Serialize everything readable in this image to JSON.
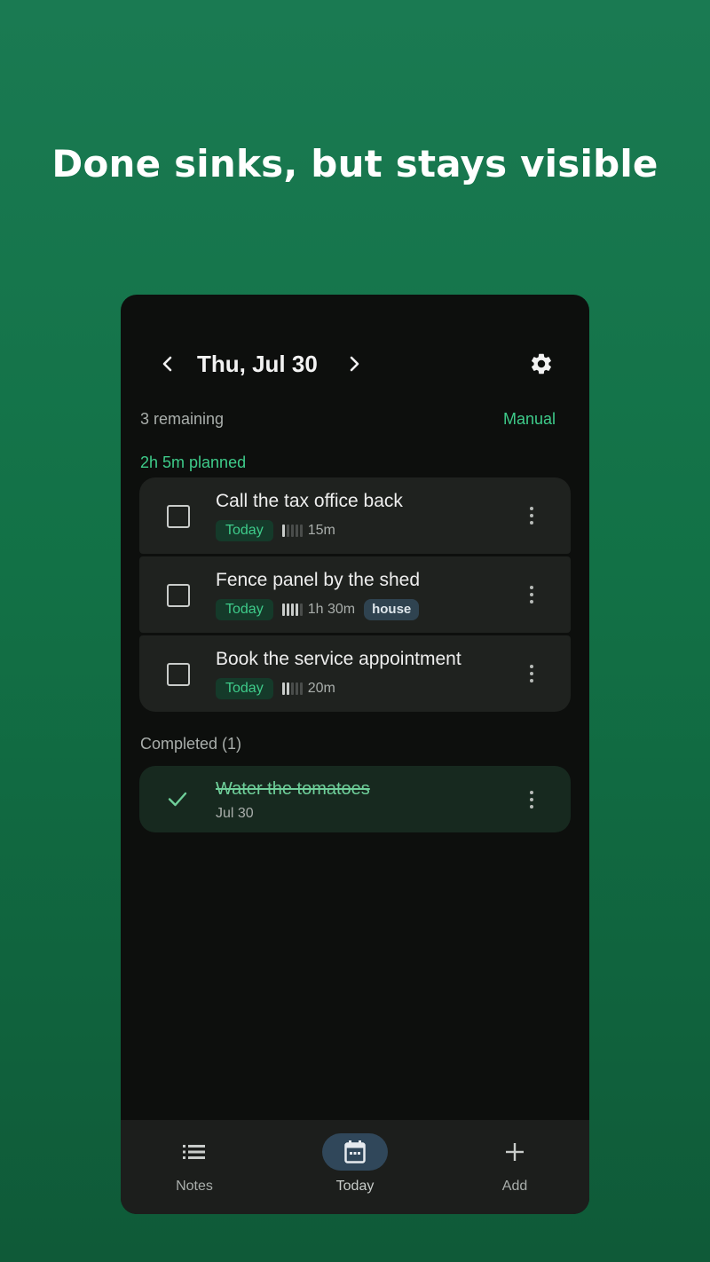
{
  "headline": "Done sinks, but stays visible",
  "header": {
    "date_title": "Thu, Jul 30",
    "prev_icon": "chevron-left-icon",
    "next_icon": "chevron-right-icon",
    "settings_icon": "gear-icon"
  },
  "summary": {
    "remaining": "3 remaining",
    "sort_mode": "Manual",
    "planned": "2h 5m planned"
  },
  "tasks": [
    {
      "title": "Call the tax office back",
      "when": "Today",
      "effort_level": 1,
      "effort_max": 5,
      "duration": "15m",
      "tag": ""
    },
    {
      "title": "Fence panel by the shed",
      "when": "Today",
      "effort_level": 4,
      "effort_max": 5,
      "duration": "1h 30m",
      "tag": "house"
    },
    {
      "title": "Book the service appointment",
      "when": "Today",
      "effort_level": 2,
      "effort_max": 5,
      "duration": "20m",
      "tag": ""
    }
  ],
  "completed": {
    "header": "Completed (1)",
    "items": [
      {
        "title": "Water the tomatoes",
        "date": "Jul 30"
      }
    ]
  },
  "bottom_nav": [
    {
      "label": "Notes",
      "icon": "list-icon",
      "active": false
    },
    {
      "label": "Today",
      "icon": "calendar-icon",
      "active": true
    },
    {
      "label": "Add",
      "icon": "plus-icon",
      "active": false
    }
  ],
  "colors": {
    "accent": "#3ecb8a",
    "background_gradient_top": "#1a7a52",
    "card": "#1f221f",
    "completed_card": "#17291f",
    "tag": "#2f4350"
  }
}
